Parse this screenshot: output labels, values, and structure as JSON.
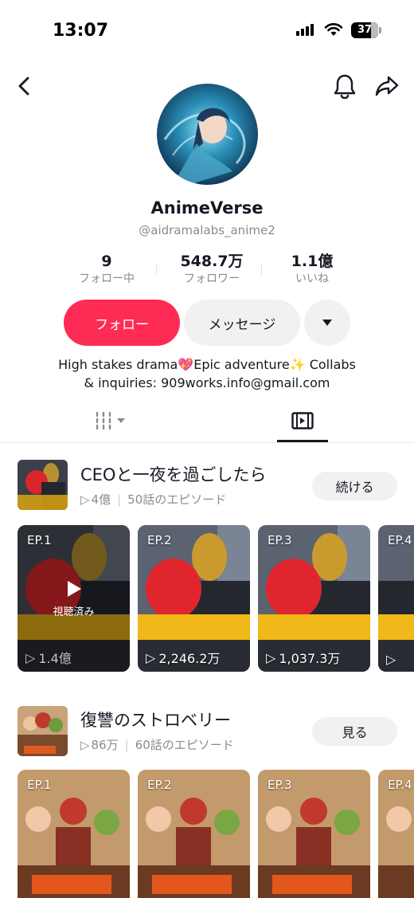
{
  "status_bar": {
    "time": "13:07",
    "battery": "37"
  },
  "profile": {
    "display_name": "AnimeVerse",
    "username": "@aidramalabs_anime2"
  },
  "stats": [
    {
      "value": "9",
      "label": "フォロー中"
    },
    {
      "value": "548.7万",
      "label": "フォロワー"
    },
    {
      "value": "1.1億",
      "label": "いいね"
    }
  ],
  "actions": {
    "follow": "フォロー",
    "message": "メッセージ"
  },
  "bio": {
    "line1": "High stakes drama💖Epic adventure✨ Collabs",
    "line2": "& inquiries: 909works.info@gmail.com"
  },
  "colors": {
    "accent": "#fe2c55",
    "text": "#161823",
    "secondary": "#8a8b91",
    "button_bg": "#f1f1f2"
  },
  "series": [
    {
      "title": "CEOと一夜を過ごしたら",
      "views": "4億",
      "episodes_count": "50話のエピソード",
      "button": "続ける",
      "episodes": [
        {
          "label": "EP.1",
          "views": "1.4億",
          "watched": "視聴済み"
        },
        {
          "label": "EP.2",
          "views": "2,246.2万"
        },
        {
          "label": "EP.3",
          "views": "1,037.3万"
        },
        {
          "label": "EP.4",
          "views": ""
        }
      ]
    },
    {
      "title": "復讐のストロベリー",
      "views": "86万",
      "episodes_count": "60話のエピソード",
      "button": "見る",
      "episodes": [
        {
          "label": "EP.1"
        },
        {
          "label": "EP.2"
        },
        {
          "label": "EP.3"
        },
        {
          "label": "EP.4"
        }
      ]
    }
  ]
}
